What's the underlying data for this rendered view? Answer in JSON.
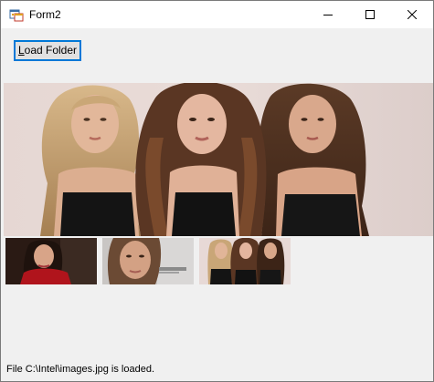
{
  "window": {
    "title": "Form2",
    "app_icon": "winforms-form-icon",
    "controls": {
      "minimize_icon": "minimize-icon",
      "maximize_icon": "maximize-icon",
      "close_icon": "close-icon"
    }
  },
  "toolbar": {
    "load_folder_label": "Load Folder",
    "load_folder_accelerator": "L"
  },
  "gallery": {
    "main_picture": "three-women-group-photo",
    "thumbnails": [
      "woman-red-outfit-portrait",
      "woman-close-up-portrait",
      "three-women-group-photo"
    ]
  },
  "status": {
    "text": "File C:\\Intel\\images.jpg is loaded."
  },
  "colors": {
    "window_background": "#f0f0f0",
    "titlebar_background": "#ffffff",
    "button_focus_border": "#0078d7",
    "button_background": "#e1e1e1"
  }
}
